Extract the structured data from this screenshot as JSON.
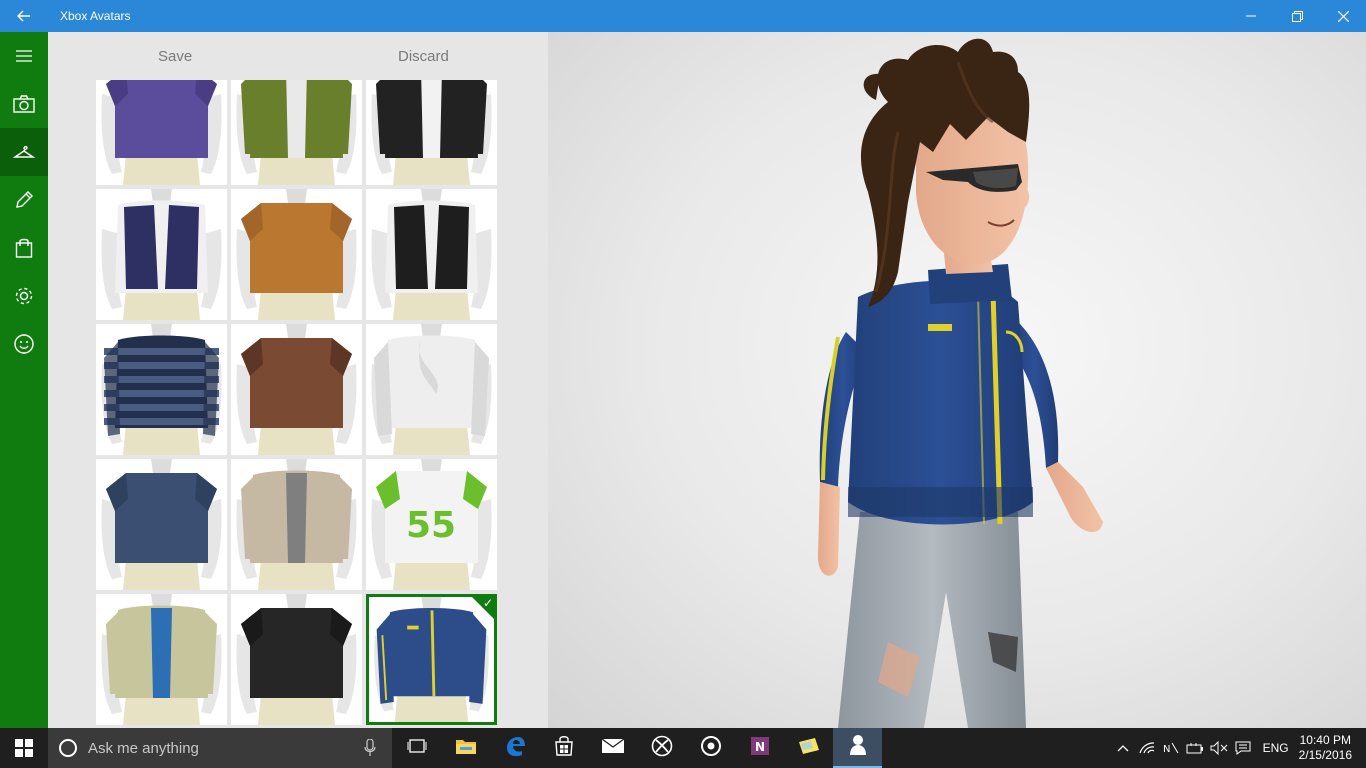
{
  "window": {
    "title": "Xbox Avatars"
  },
  "commandbar": {
    "save_label": "Save",
    "discard_label": "Discard"
  },
  "nav": {
    "items": [
      {
        "icon": "hamburger-menu-icon"
      },
      {
        "icon": "camera-icon"
      },
      {
        "icon": "hanger-icon",
        "active": true
      },
      {
        "icon": "pencil-icon"
      },
      {
        "icon": "shopping-bag-icon"
      },
      {
        "icon": "gear-icon"
      },
      {
        "icon": "smiley-icon"
      }
    ]
  },
  "grid": {
    "tiles": [
      {
        "name": "purple-tshirt",
        "colors": [
          "#5b4d9c",
          "#4a3d86"
        ],
        "style": "tee"
      },
      {
        "name": "green-jacket",
        "colors": [
          "#6a7f2c",
          "#e9e9e9"
        ],
        "style": "open"
      },
      {
        "name": "black-leather-jacket",
        "colors": [
          "#222222",
          "#f2f2f2"
        ],
        "style": "open"
      },
      {
        "name": "navy-vest",
        "colors": [
          "#2e2f62",
          "#f0f0f0"
        ],
        "style": "vest"
      },
      {
        "name": "orange-print-shirt",
        "colors": [
          "#b9772f",
          "#a3652a"
        ],
        "style": "tee"
      },
      {
        "name": "black-rock-vest",
        "colors": [
          "#1e1e1e",
          "#f0f0f0"
        ],
        "style": "vest"
      },
      {
        "name": "navy-striped-sweater",
        "colors": [
          "#22304e",
          "#4a5c82"
        ],
        "style": "stripes"
      },
      {
        "name": "brown-plaid-shirt",
        "colors": [
          "#7a4a33",
          "#5d3625"
        ],
        "style": "tee"
      },
      {
        "name": "white-ruffle-shirt",
        "colors": [
          "#eeeeee",
          "#d9d9d9"
        ],
        "style": "long"
      },
      {
        "name": "navy-skater-tee",
        "colors": [
          "#3a4f72",
          "#2e415f"
        ],
        "style": "tee"
      },
      {
        "name": "beige-jacket",
        "colors": [
          "#c5b9a4",
          "#7f7f7f"
        ],
        "style": "open"
      },
      {
        "name": "green-jersey-55",
        "colors": [
          "#f3f3f3",
          "#6bbf2c"
        ],
        "style": "jersey",
        "number": "55"
      },
      {
        "name": "khaki-jacket",
        "colors": [
          "#c6c59c",
          "#2d6fb4"
        ],
        "style": "open"
      },
      {
        "name": "black-skull-tee",
        "colors": [
          "#262626",
          "#1a1a1a"
        ],
        "style": "tee"
      },
      {
        "name": "blue-track-jacket",
        "colors": [
          "#2c4c8a",
          "#e0d02c"
        ],
        "style": "track",
        "selected": true
      }
    ]
  },
  "taskbar": {
    "search_placeholder": "Ask me anything",
    "apps": [
      {
        "icon": "task-view-icon"
      },
      {
        "icon": "file-explorer-icon"
      },
      {
        "icon": "edge-icon"
      },
      {
        "icon": "store-icon"
      },
      {
        "icon": "mail-icon"
      },
      {
        "icon": "xbox-icon"
      },
      {
        "icon": "groove-music-icon"
      },
      {
        "icon": "onenote-icon"
      },
      {
        "icon": "sticky-notes-icon"
      },
      {
        "icon": "xbox-avatars-icon",
        "active": true
      }
    ],
    "language": "ENG",
    "time": "10:40 PM",
    "date": "2/15/2016"
  }
}
